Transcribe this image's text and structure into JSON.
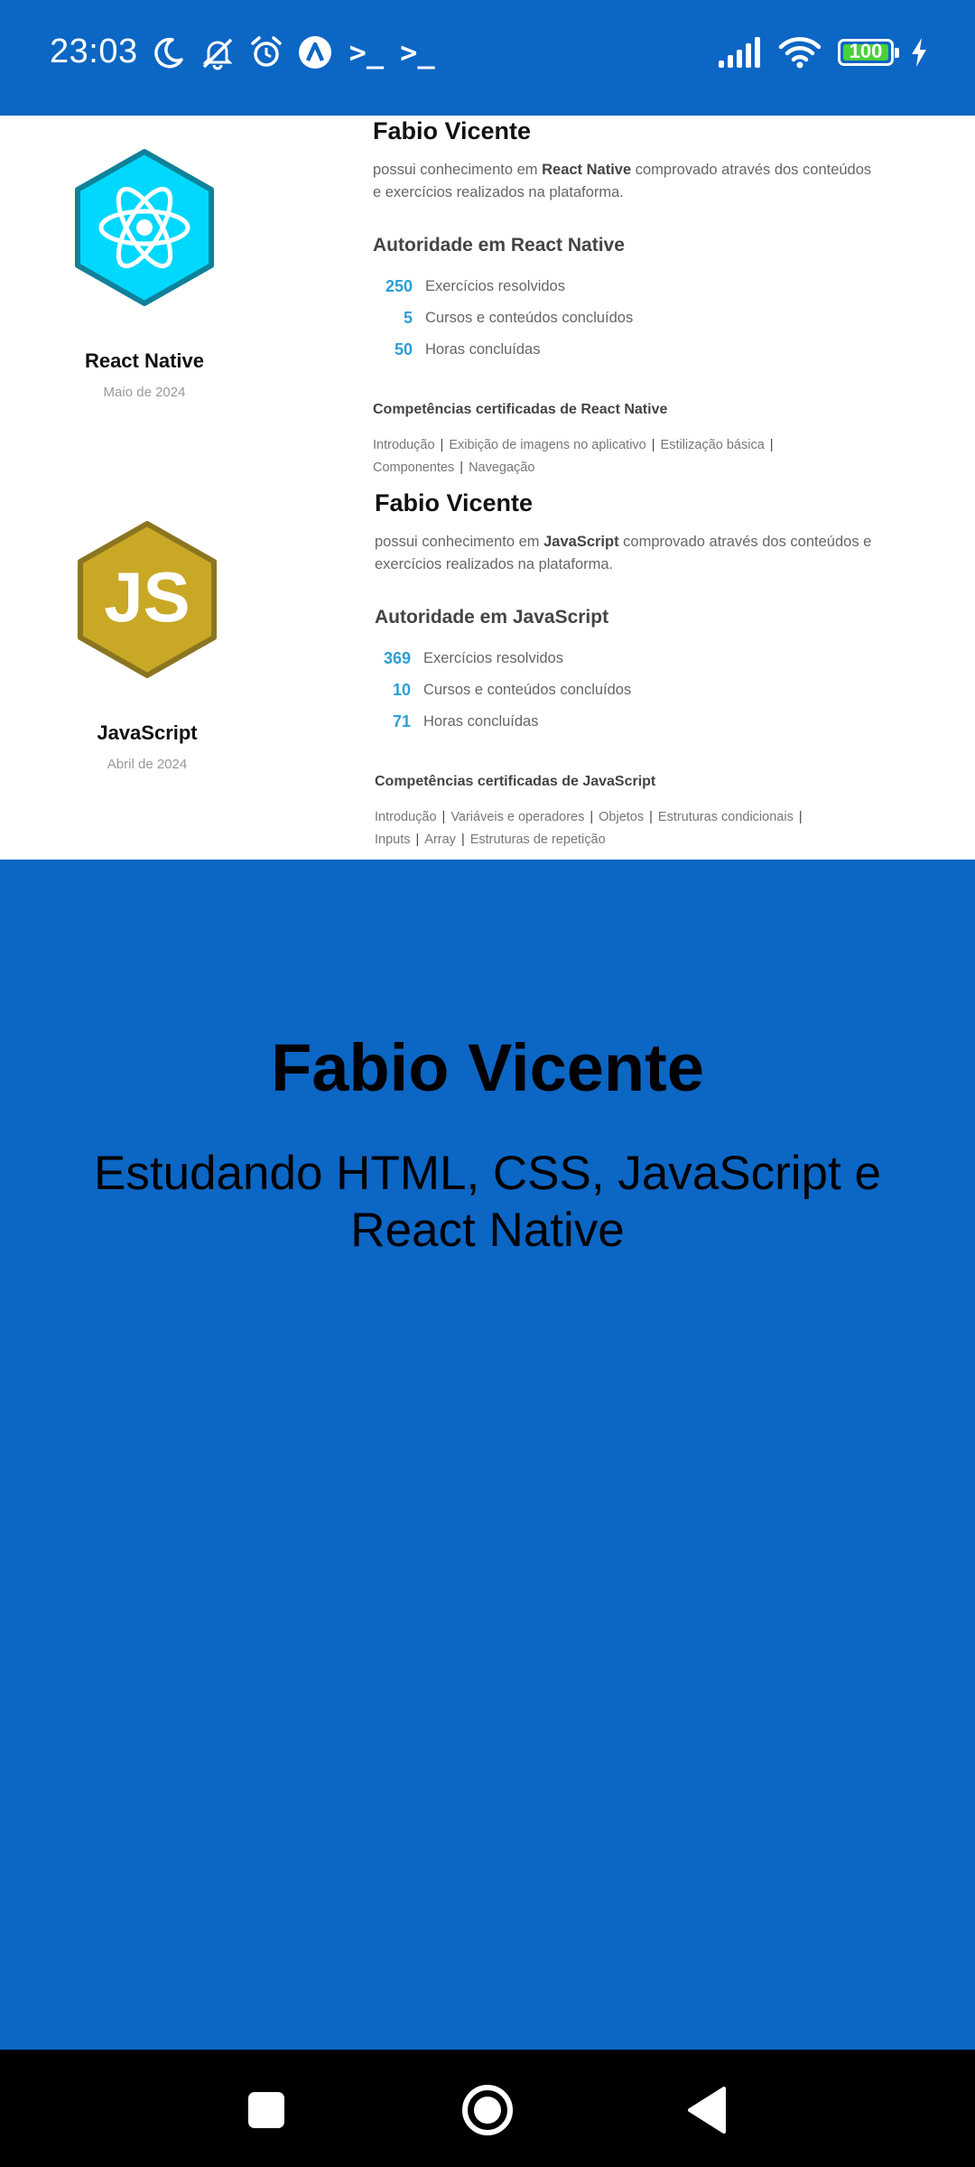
{
  "status_bar": {
    "time": "23:03",
    "icons_left": [
      "moon-icon",
      "bell-off-icon",
      "alarm-icon",
      "app-a-icon",
      "terminal-icon",
      "terminal-icon"
    ],
    "terminal_glyph": ">_",
    "battery_level": "100",
    "icons_right": [
      "signal-icon",
      "wifi-icon",
      "battery-icon",
      "charging-icon"
    ]
  },
  "certificates": [
    {
      "tech": "React Native",
      "date": "Maio de 2024",
      "holder": "Fabio Vicente",
      "desc_prefix": "possui conhecimento em ",
      "desc_bold": "React Native",
      "desc_suffix": " comprovado através dos conteúdos e exercícios realizados na plataforma.",
      "authority_title": "Autoridade em React Native",
      "stats": [
        {
          "num": "250",
          "label": "Exercícios resolvidos"
        },
        {
          "num": "5",
          "label": "Cursos e conteúdos concluídos"
        },
        {
          "num": "50",
          "label": "Horas concluídas"
        }
      ],
      "competencies_title": "Competências certificadas de React Native",
      "competencies": [
        "Introdução",
        "Exibição de imagens no aplicativo",
        "Estilização básica",
        "Componentes",
        "Navegação"
      ]
    },
    {
      "tech": "JavaScript",
      "date": "Abril de 2024",
      "holder": "Fabio Vicente",
      "desc_prefix": "possui conhecimento em ",
      "desc_bold": "JavaScript",
      "desc_suffix": " comprovado através dos conteúdos e exercícios realizados na plataforma.",
      "authority_title": "Autoridade em JavaScript",
      "stats": [
        {
          "num": "369",
          "label": "Exercícios resolvidos"
        },
        {
          "num": "10",
          "label": "Cursos e conteúdos concluídos"
        },
        {
          "num": "71",
          "label": "Horas concluídas"
        }
      ],
      "competencies_title": "Competências certificadas de JavaScript",
      "competencies": [
        "Introdução",
        "Variáveis e operadores",
        "Objetos",
        "Estruturas condicionais",
        "Inputs",
        "Array",
        "Estruturas de repetição"
      ],
      "badge_text": "JS"
    }
  ],
  "main": {
    "name": "Fabio Vicente",
    "subtitle": "Estudando HTML, CSS, JavaScript e React Native"
  },
  "colors": {
    "background": "#0c66c4",
    "react_badge": "#00d8ff",
    "js_badge": "#c9a826",
    "stat_number": "#2a9fd6"
  },
  "navigation": [
    "recents-button",
    "home-button",
    "back-button"
  ]
}
